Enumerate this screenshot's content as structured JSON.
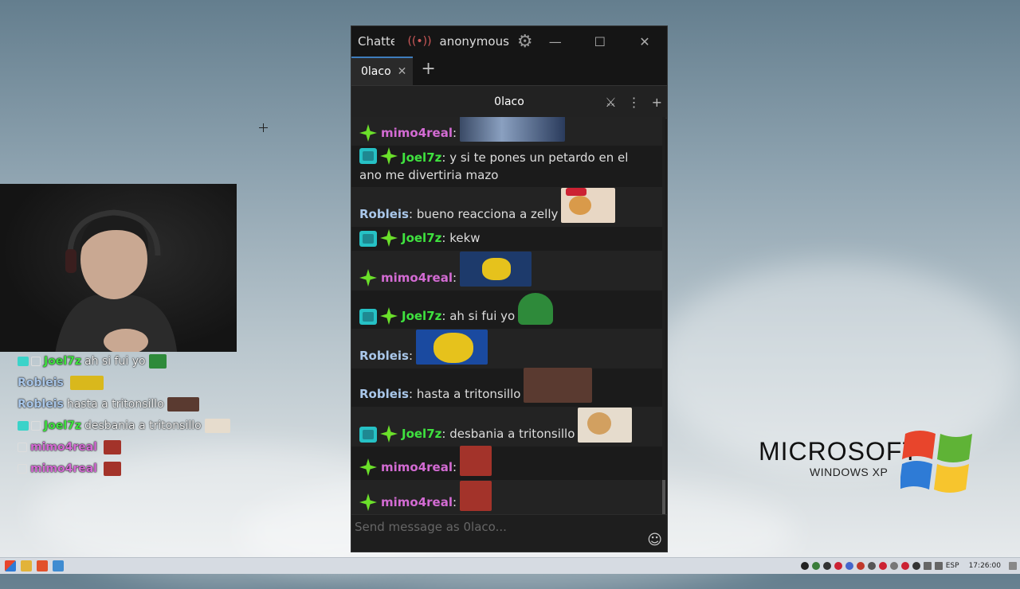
{
  "window": {
    "app_title": "Chatterino",
    "live_icon": "broadcast-icon",
    "account": "anonymous",
    "settings_icon": "gear-icon"
  },
  "tabs": [
    {
      "label": "0laco"
    }
  ],
  "split": {
    "channel": "0laco"
  },
  "messages": [
    {
      "badges": [
        "star"
      ],
      "user": "mimo4real",
      "colon": ":",
      "text": "",
      "emote_color": "#6a7fa0"
    },
    {
      "badges": [
        "88",
        "star"
      ],
      "user": "Joel7z",
      "colon": ":",
      "text": "y si te pones un petardo en el ano me divertiria mazo"
    },
    {
      "badges": [],
      "user": "Robleis",
      "colon": ":",
      "text": "bueno reacciona a zelly",
      "emote_color": "#e8d7c4"
    },
    {
      "badges": [
        "88",
        "star"
      ],
      "user": "Joel7z",
      "colon": ":",
      "text": "kekw"
    },
    {
      "badges": [
        "star"
      ],
      "user": "mimo4real",
      "colon": ":",
      "text": "",
      "emote_color": "#1d3a6b"
    },
    {
      "badges": [
        "88",
        "star"
      ],
      "user": "Joel7z",
      "colon": ":",
      "text": "ah si fui yo",
      "emote_color": "#2e8a3a"
    },
    {
      "badges": [],
      "user": "Robleis",
      "colon": ":",
      "text": "",
      "emote_color": "#e6c21c"
    },
    {
      "badges": [],
      "user": "Robleis",
      "colon": ":",
      "text": "hasta a tritonsillo",
      "emote_color": "#5a3a30"
    },
    {
      "badges": [
        "88",
        "star"
      ],
      "user": "Joel7z",
      "colon": ":",
      "text": "desbania a tritonsillo",
      "emote_color": "#e6dccd"
    },
    {
      "badges": [
        "star"
      ],
      "user": "mimo4real",
      "colon": ":",
      "text": "",
      "emote_color": "#a3332a"
    },
    {
      "badges": [
        "star"
      ],
      "user": "mimo4real",
      "colon": ":",
      "text": "",
      "emote_color": "#a3332a"
    }
  ],
  "input": {
    "placeholder": "Send message as 0laco..."
  },
  "overlay_chat": [
    {
      "user": "Joel7z",
      "text": "ah si fui yo",
      "color": "#3fe23f",
      "emote": "#2e8a3a"
    },
    {
      "user": "Robleis",
      "text": "",
      "color": "#a9c7ea",
      "emote": "#d9b81c"
    },
    {
      "user": "Robleis",
      "text": "hasta a tritonsillo",
      "color": "#a9c7ea",
      "emote": "#5a3a30"
    },
    {
      "user": "Joel7z",
      "text": "desbania a tritonsillo",
      "color": "#3fe23f",
      "emote": "#e6dccd"
    },
    {
      "user": "mimo4real",
      "text": "",
      "color": "#d36bd3",
      "emote": "#a3332a"
    },
    {
      "user": "mimo4real",
      "text": "",
      "color": "#d36bd3",
      "emote": "#a3332a"
    }
  ],
  "desktop_logo": {
    "brand": "MICROSOFT",
    "product": "WINDOWS XP"
  },
  "taskbar": {
    "lang": "ESP",
    "clock": "17:26:00"
  }
}
